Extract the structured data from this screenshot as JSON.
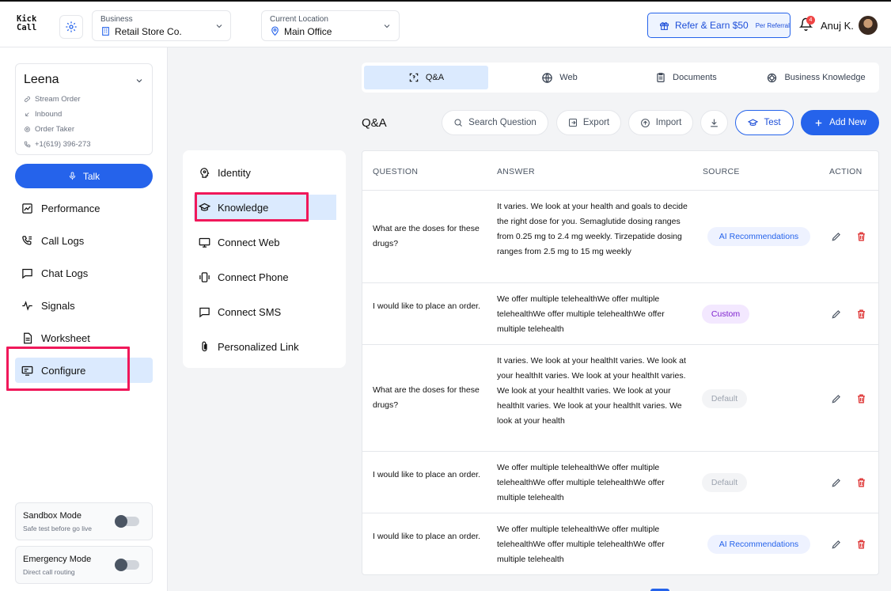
{
  "header": {
    "logo_line1": "Kick",
    "logo_line2": "Call",
    "business_label": "Business",
    "business_value": "Retail Store Co.",
    "location_label": "Current Location",
    "location_value": "Main Office",
    "refer_label": "Refer & Earn $50",
    "refer_sub": "Per Referral",
    "notification_count": "4",
    "user_name": "Anuj K."
  },
  "sidebar": {
    "agent_name": "Leena",
    "meta": [
      "Stream Order",
      "Inbound",
      "Order Taker",
      "+1(619) 396-273"
    ],
    "talk_label": "Talk",
    "nav": [
      "Performance",
      "Call Logs",
      "Chat Logs",
      "Signals",
      "Worksheet",
      "Configure"
    ],
    "active_nav": "Configure",
    "sandbox_title": "Sandbox Mode",
    "sandbox_sub": "Safe test before go live",
    "emergency_title": "Emergency Mode",
    "emergency_sub": "Direct call routing"
  },
  "config_menu": {
    "items": [
      "Identity",
      "Knowledge",
      "Connect Web",
      "Connect Phone",
      "Connect SMS",
      "Personalized Link"
    ],
    "active": "Knowledge"
  },
  "tabs": {
    "items": [
      "Q&A",
      "Web",
      "Documents",
      "Business Knowledge"
    ],
    "active": "Q&A"
  },
  "main": {
    "title": "Q&A",
    "search_label": "Search Question",
    "export_label": "Export",
    "import_label": "Import",
    "test_label": "Test",
    "add_label": "Add New"
  },
  "table": {
    "headers": [
      "QUESTION",
      "ANSWER",
      "SOURCE",
      "ACTION"
    ],
    "rows": [
      {
        "question": "What are the doses for these drugs?",
        "answer": "It varies. We look at your health and goals to decide the right dose for you. Semaglutide dosing ranges from 0.25 mg to 2.4 mg weekly. Tirzepatide dosing ranges from 2.5 mg to 15 mg weekly",
        "source": "AI Recommendations"
      },
      {
        "question": "I would like to place an order.",
        "answer": "We offer multiple telehealthWe offer multiple telehealthWe offer multiple telehealthWe offer multiple telehealth",
        "source": "Custom"
      },
      {
        "question": "What are the doses for these drugs?",
        "answer": "It varies. We look at your healthIt varies. We look at your healthIt varies. We look at your healthIt varies. We look at your healthIt varies. We look at your healthIt varies. We look at your healthIt varies. We look at your health",
        "source": "Default"
      },
      {
        "question": "I would like to place an order.",
        "answer": "We offer multiple telehealthWe offer multiple telehealthWe offer multiple telehealthWe offer multiple telehealth",
        "source": "Default"
      },
      {
        "question": "I would like to place an order.",
        "answer": "We offer multiple telehealthWe offer multiple telehealthWe offer multiple telehealthWe offer multiple telehealth",
        "source": "AI Recommendations"
      }
    ]
  },
  "colors": {
    "accent": "#2563eb",
    "active_bg": "#dbeafe",
    "highlight_box": "#f0185a",
    "delete": "#dc2626"
  }
}
